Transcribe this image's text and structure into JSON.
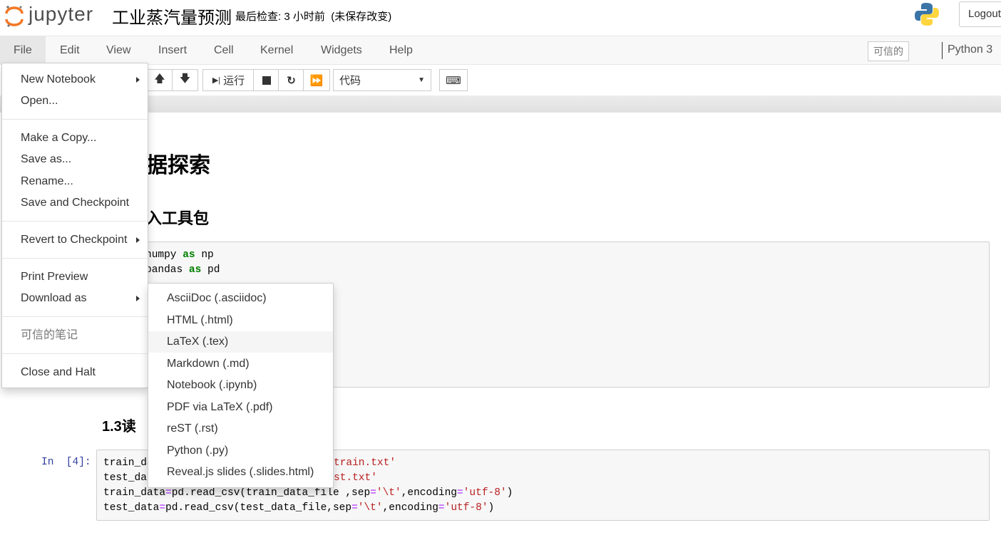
{
  "header": {
    "logo_text": "jupyter",
    "notebook_title": "工业蒸汽量预测",
    "checkpoint": "最后检查: 3 小时前",
    "unsaved": "(未保存改变)",
    "logout": "Logout"
  },
  "menubar": {
    "items": [
      "File",
      "Edit",
      "View",
      "Insert",
      "Cell",
      "Kernel",
      "Widgets",
      "Help"
    ],
    "trusted": "可信的",
    "kernel": "Python 3"
  },
  "toolbar": {
    "run_label": "运行",
    "cell_type": "代码"
  },
  "file_menu": {
    "items": [
      "New Notebook",
      "Open...",
      "Make a Copy...",
      "Save as...",
      "Rename...",
      "Save and Checkpoint",
      "Revert to Checkpoint",
      "Print Preview",
      "Download as",
      "可信的笔记",
      "Close and Halt"
    ]
  },
  "download_menu": {
    "items": [
      "AsciiDoc (.asciidoc)",
      "HTML (.html)",
      "LaTeX (.tex)",
      "Markdown (.md)",
      "Notebook (.ipynb)",
      "PDF via LaTeX (.pdf)",
      "reST (.rst)",
      "Python (.py)",
      "Reveal.js slides (.slides.html)"
    ],
    "highlighted": "LaTeX (.tex)"
  },
  "notebook": {
    "h1_visible": "据探索",
    "h2_visible": "入工具包",
    "h3_visible": "1.3读",
    "cell1": {
      "l1a": "numpy ",
      "l1kw": "as",
      "l1b": " np",
      "l2a": "pandas ",
      "l2kw": "as",
      "l2b": " pd"
    },
    "cell2": {
      "prompt": "In  [4]:",
      "l1a": "train_da",
      "l1b": "train.txt'",
      "l2a": "test_da",
      "l2b": "st.txt'",
      "l3": [
        "train_data",
        "=",
        "pd.read_csv(train_data_file ,sep",
        "=",
        "'\\t'",
        ",encoding",
        "=",
        "'utf-8'",
        ")"
      ],
      "l4": [
        "test_data",
        "=",
        "pd.read_csv(test_data_file,sep",
        "=",
        "'\\t'",
        ",encoding",
        "=",
        "'utf-8'",
        ")"
      ]
    }
  }
}
